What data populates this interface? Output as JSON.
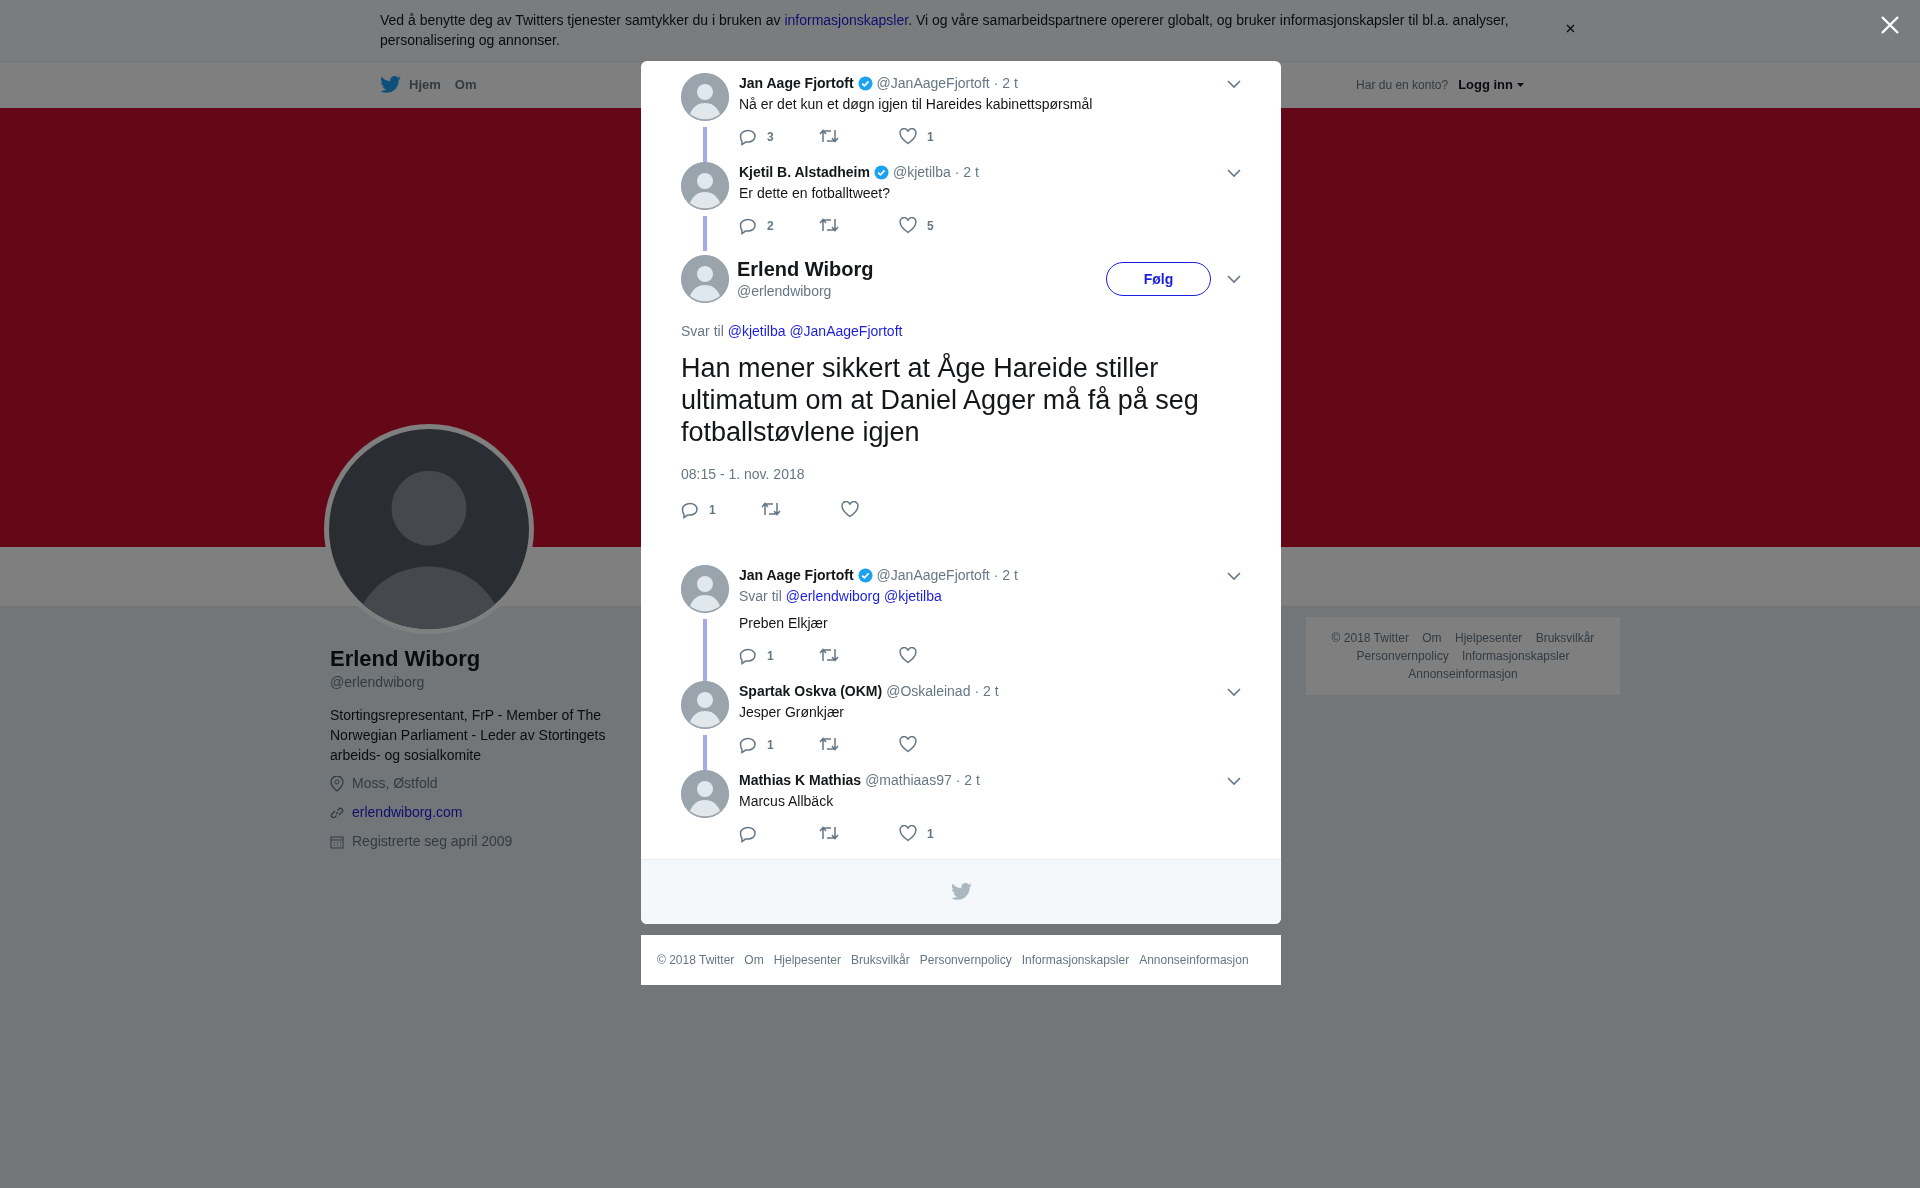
{
  "cookie_banner": {
    "before": "Ved å benytte deg av Twitters tjenester samtykker du i bruken av ",
    "link": "informasjonskapsler",
    "after": ". Vi og våre samarbeidspartnere opererer globalt, og bruker informasjonskapsler til bl.a. analyser, personalisering og annonser."
  },
  "nav": {
    "items": [
      {
        "label": "Hjem",
        "kind": "home"
      },
      {
        "label": "Om",
        "kind": "link"
      }
    ],
    "login_prompt": "Har du en konto?",
    "login": "Logg inn"
  },
  "profile": {
    "name": "Erlend Wiborg",
    "handle": "@erlendwiborg",
    "bio": "Stortingsrepresentant, FrP - Member of The Norwegian Parliament - Leder av Stortingets arbeids- og sosialkomite",
    "location": "Moss, Østfold",
    "website": "erlendwiborg.com",
    "joined": "Registrerte seg april 2009"
  },
  "side_footer": {
    "links": [
      "© 2018 Twitter",
      "Om",
      "Hjelpesenter",
      "Bruksvilkår",
      "Personvernpolicy",
      "Informasjonskapsler",
      "Annonseinformasjon"
    ]
  },
  "modal": {
    "ancestors": [
      {
        "name": "Jan Aage Fjortoft",
        "verified": true,
        "handle": "@JanAageFjortoft",
        "time": "· 2 t",
        "text": "Nå er det kun et døgn igjen til Hareides kabinettspørsmål",
        "replies": "3",
        "likes": "1",
        "connected": true
      },
      {
        "name": "Kjetil B. Alstadheim",
        "verified": true,
        "handle": "@kjetilba",
        "time": "· 2 t",
        "text": "Er dette en fotballtweet?",
        "replies": "2",
        "likes": "5",
        "connected": true
      }
    ],
    "main_tweet": {
      "name": "Erlend Wiborg",
      "handle": "@erlendwiborg",
      "follow": "Følg",
      "reply_label": "Svar til",
      "reply_to": [
        "@kjetilba",
        "@JanAageFjortoft"
      ],
      "text": "Han mener sikkert at Åge Hareide stiller ultimatum om at Daniel Agger må få på seg fotballstøvlene igjen",
      "date": "08:15 - 1. nov. 2018",
      "replies": "1"
    },
    "replies": [
      {
        "name": "Jan Aage Fjortoft",
        "verified": true,
        "handle": "@JanAageFjortoft",
        "time": "· 2 t",
        "reply_label": "Svar til",
        "reply_to": [
          "@erlendwiborg",
          "@kjetilba"
        ],
        "text": "Preben Elkjær",
        "replies": "1",
        "connected": true
      },
      {
        "name": "Spartak Oskva (OKM)",
        "verified": false,
        "handle": "@Oskaleinad",
        "time": "· 2 t",
        "text": "Jesper Grønkjær",
        "replies": "1",
        "connected": true
      },
      {
        "name": "Mathias K Mathias",
        "verified": false,
        "handle": "@mathiaas97",
        "time": "· 2 t",
        "text": "Marcus Allbäck",
        "likes": "1",
        "connected": false
      }
    ],
    "footer_links": [
      "© 2018 Twitter",
      "Om",
      "Hjelpesenter",
      "Bruksvilkår",
      "Personvernpolicy",
      "Informasjonskapsler",
      "Annonseinformasjon"
    ]
  }
}
